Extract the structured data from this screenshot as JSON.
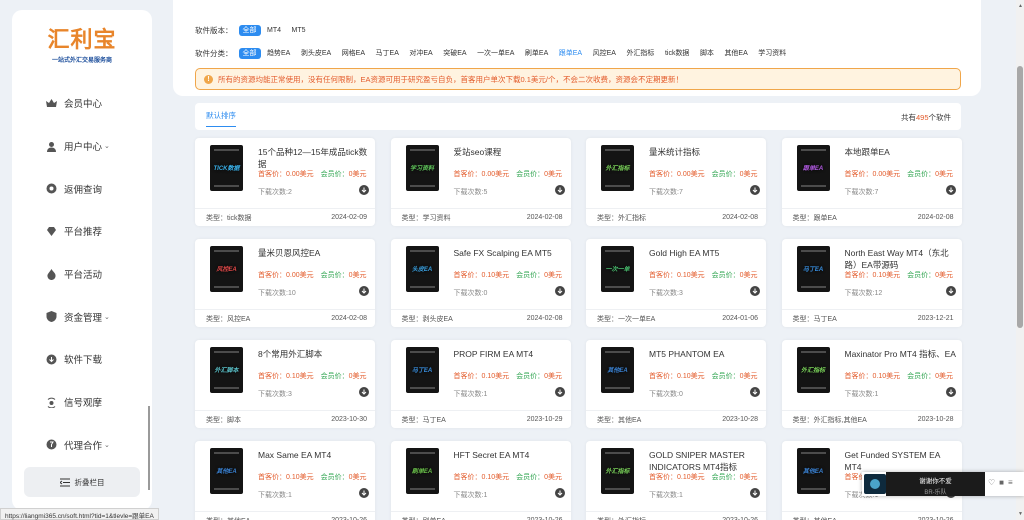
{
  "logo": {
    "title": "汇利宝",
    "subtitle": "一站式外汇交易服务商"
  },
  "sidebar": {
    "items": [
      {
        "label": "会员中心",
        "icon": "crown-icon",
        "has_arrow": false
      },
      {
        "label": "用户中心",
        "icon": "user-icon",
        "has_arrow": true
      },
      {
        "label": "返佣查询",
        "icon": "search-icon",
        "has_arrow": false
      },
      {
        "label": "平台推荐",
        "icon": "diamond-icon",
        "has_arrow": false
      },
      {
        "label": "平台活动",
        "icon": "fire-icon",
        "has_arrow": false
      },
      {
        "label": "资金管理",
        "icon": "shield-icon",
        "has_arrow": true
      },
      {
        "label": "软件下载",
        "icon": "download-icon",
        "has_arrow": false
      },
      {
        "label": "信号观摩",
        "icon": "signal-icon",
        "has_arrow": false
      },
      {
        "label": "代理合作",
        "icon": "coin-icon",
        "has_arrow": true
      }
    ],
    "collapse_label": "折叠栏目"
  },
  "filters": {
    "version_label": "软件版本：",
    "versions": [
      "全部",
      "MT4",
      "MT5"
    ],
    "category_label": "软件分类：",
    "categories": [
      "全部",
      "趋势EA",
      "剥头皮EA",
      "网格EA",
      "马丁EA",
      "对冲EA",
      "突破EA",
      "一次一单EA",
      "刷单EA",
      "跟单EA",
      "风控EA",
      "外汇指标",
      "tick数据",
      "脚本",
      "其他EA",
      "学习资料"
    ]
  },
  "notice": "所有的资源均能正常使用，没有任何限制，EA资源可用于研究盈亏自负，首客用户单次下载0.1美元/个，不会二次收费，资源会不定期更新！",
  "tabs": {
    "active": "默认排序",
    "count_prefix": "共有",
    "count": "495",
    "count_suffix": "个软件"
  },
  "labels": {
    "visitor_price": "首客价：",
    "member_price": "会员价：",
    "downloads": "下载次数:",
    "type": "类型："
  },
  "cards": [
    {
      "title": "15个品种12—15年成品tick数据",
      "thumb": "TICK数据",
      "visitor": "0.00美元",
      "member": "0美元",
      "downloads": "2",
      "type": "tick数据",
      "date": "2024-02-09",
      "color": "#3ab0e8"
    },
    {
      "title": "爱站seo课程",
      "thumb": "学习资料",
      "visitor": "0.00美元",
      "member": "0美元",
      "downloads": "5",
      "type": "学习资料",
      "date": "2024-02-08",
      "color": "#5ec25a"
    },
    {
      "title": "量米统计指标",
      "thumb": "外汇指标",
      "visitor": "0.00美元",
      "member": "0美元",
      "downloads": "7",
      "type": "外汇指标",
      "date": "2024-02-08",
      "color": "#7ad15a"
    },
    {
      "title": "本地跟单EA",
      "thumb": "跟单EA",
      "visitor": "0.00美元",
      "member": "0美元",
      "downloads": "7",
      "type": "跟单EA",
      "date": "2024-02-08",
      "color": "#b05ae0"
    },
    {
      "title": "量米贝恩风控EA",
      "thumb": "风控EA",
      "visitor": "0.00美元",
      "member": "0美元",
      "downloads": "10",
      "type": "风控EA",
      "date": "2024-02-08",
      "color": "#e04848"
    },
    {
      "title": "Safe FX Scalping EA MT5",
      "thumb": "头皮EA",
      "visitor": "0.10美元",
      "member": "0美元",
      "downloads": "0",
      "type": "剥头皮EA",
      "date": "2024-02-08",
      "color": "#3aa0e0"
    },
    {
      "title": "Gold High EA MT5",
      "thumb": "一次一单",
      "visitor": "0.10美元",
      "member": "0美元",
      "downloads": "3",
      "type": "一次一单EA",
      "date": "2024-01-06",
      "color": "#4ac070"
    },
    {
      "title": "North East Way MT4（东北路）EA带源码",
      "thumb": "马丁EA",
      "visitor": "0.10美元",
      "member": "0美元",
      "downloads": "12",
      "type": "马丁EA",
      "date": "2023-12-21",
      "color": "#3a90e0"
    },
    {
      "title": "8个常用外汇脚本",
      "thumb": "外汇脚本",
      "visitor": "0.10美元",
      "member": "0美元",
      "downloads": "3",
      "type": "脚本",
      "date": "2023-10-30",
      "color": "#5ac0c8"
    },
    {
      "title": "PROP FIRM EA MT4",
      "thumb": "马丁EA",
      "visitor": "0.10美元",
      "member": "0美元",
      "downloads": "1",
      "type": "马丁EA",
      "date": "2023-10-29",
      "color": "#3a90e0"
    },
    {
      "title": "MT5 PHANTOM EA",
      "thumb": "其他EA",
      "visitor": "0.10美元",
      "member": "0美元",
      "downloads": "0",
      "type": "其他EA",
      "date": "2023-10-28",
      "color": "#3a80d0"
    },
    {
      "title": "Maxinator Pro MT4 指标、EA",
      "thumb": "外汇指标",
      "visitor": "0.10美元",
      "member": "0美元",
      "downloads": "1",
      "type": "外汇指标,其他EA",
      "date": "2023-10-28",
      "color": "#7ad15a"
    },
    {
      "title": "Max Same EA MT4",
      "thumb": "其他EA",
      "visitor": "0.10美元",
      "member": "0美元",
      "downloads": "1",
      "type": "其他EA",
      "date": "2023-10-26",
      "color": "#3a80d0"
    },
    {
      "title": "HFT Secret EA MT4",
      "thumb": "刷单EA",
      "visitor": "0.10美元",
      "member": "0美元",
      "downloads": "1",
      "type": "刷单EA",
      "date": "2023-10-26",
      "color": "#6ac04a"
    },
    {
      "title": "GOLD SNIPER MASTER INDICATORS MT4指标",
      "thumb": "外汇指标",
      "visitor": "0.10美元",
      "member": "0美元",
      "downloads": "1",
      "type": "外汇指标",
      "date": "2023-10-26",
      "color": "#7ad15a"
    },
    {
      "title": "Get Funded SYSTEM EA MT4",
      "thumb": "其他EA",
      "visitor": "0.10美元",
      "member": "0美元",
      "downloads": "1",
      "type": "其他EA",
      "date": "2023-10-26",
      "color": "#3a80d0"
    }
  ],
  "status_url": "https://liangmi365.cn/soft.html?tid=1&tlevle=跟单EA",
  "player": {
    "song": "谢谢你不爱",
    "artist": "BR-乐队"
  },
  "colors": {
    "accent": "#2d8cf0",
    "price": "#e35b2b",
    "member_label": "#2ea44f",
    "logo": "#e8852b"
  }
}
